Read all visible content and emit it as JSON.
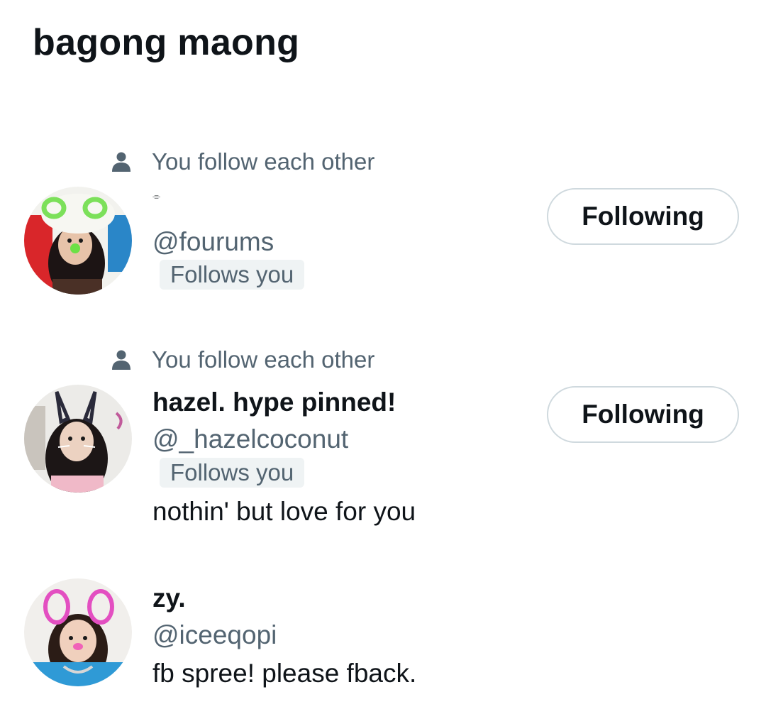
{
  "page": {
    "title": "bagong maong"
  },
  "users": [
    {
      "context": "You follow each other",
      "name": "⌯",
      "handle": "@fourums",
      "follows_you": "Follows you",
      "bio": "",
      "button_label": "Following"
    },
    {
      "context": "You follow each other",
      "name": "hazel. hype pinned!",
      "handle": "@_hazelcoconut",
      "follows_you": "Follows you",
      "bio": "nothin' but love for you",
      "button_label": "Following"
    },
    {
      "context": "",
      "name": "zy.",
      "handle": "@iceeqopi",
      "follows_you": "",
      "bio": "fb spree! please fback.",
      "button_label": ""
    }
  ],
  "colors": {
    "text_primary": "#0f1419",
    "text_secondary": "#536471",
    "badge_bg": "#eff3f4",
    "button_border": "#cfd9de"
  },
  "icons": {
    "context_icon": "person-icon"
  }
}
